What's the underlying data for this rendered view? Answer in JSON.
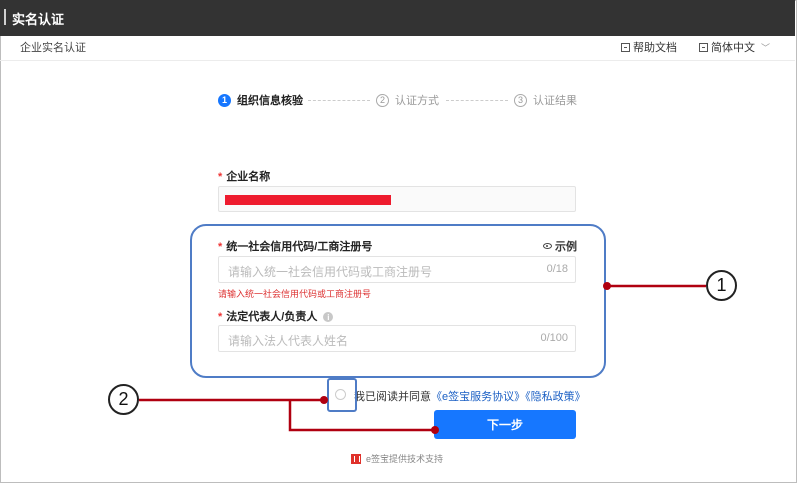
{
  "window": {
    "title": "实名认证"
  },
  "header": {
    "page_title": "企业实名认证",
    "help_label": "帮助文档",
    "language_label": "简体中文"
  },
  "steps": [
    {
      "num": "1",
      "label": "组织信息核验",
      "active": true
    },
    {
      "num": "2",
      "label": "认证方式",
      "active": false
    },
    {
      "num": "3",
      "label": "认证结果",
      "active": false
    }
  ],
  "form": {
    "company_name": {
      "required_mark": "*",
      "label": "企业名称"
    },
    "credit_code": {
      "required_mark": "*",
      "label": "统一社会信用代码/工商注册号",
      "example_label": "示例",
      "placeholder": "请输入统一社会信用代码或工商注册号",
      "counter": "0/18",
      "error": "请输入统一社会信用代码或工商注册号"
    },
    "legal_rep": {
      "required_mark": "*",
      "label": "法定代表人/负责人",
      "info_mark": "i",
      "placeholder": "请输入法人代表人姓名",
      "counter": "0/100"
    },
    "agreement": {
      "prefix": "我已阅读并同意",
      "service_link": "《e签宝服务协议》",
      "privacy_link": "《隐私政策》"
    },
    "next_label": "下一步"
  },
  "footer": {
    "text": "e签宝提供技术支持"
  },
  "annotations": {
    "callout_1": "1",
    "callout_2": "2",
    "highlight_color": "#4f7cc6",
    "line_color": "#b00010"
  }
}
